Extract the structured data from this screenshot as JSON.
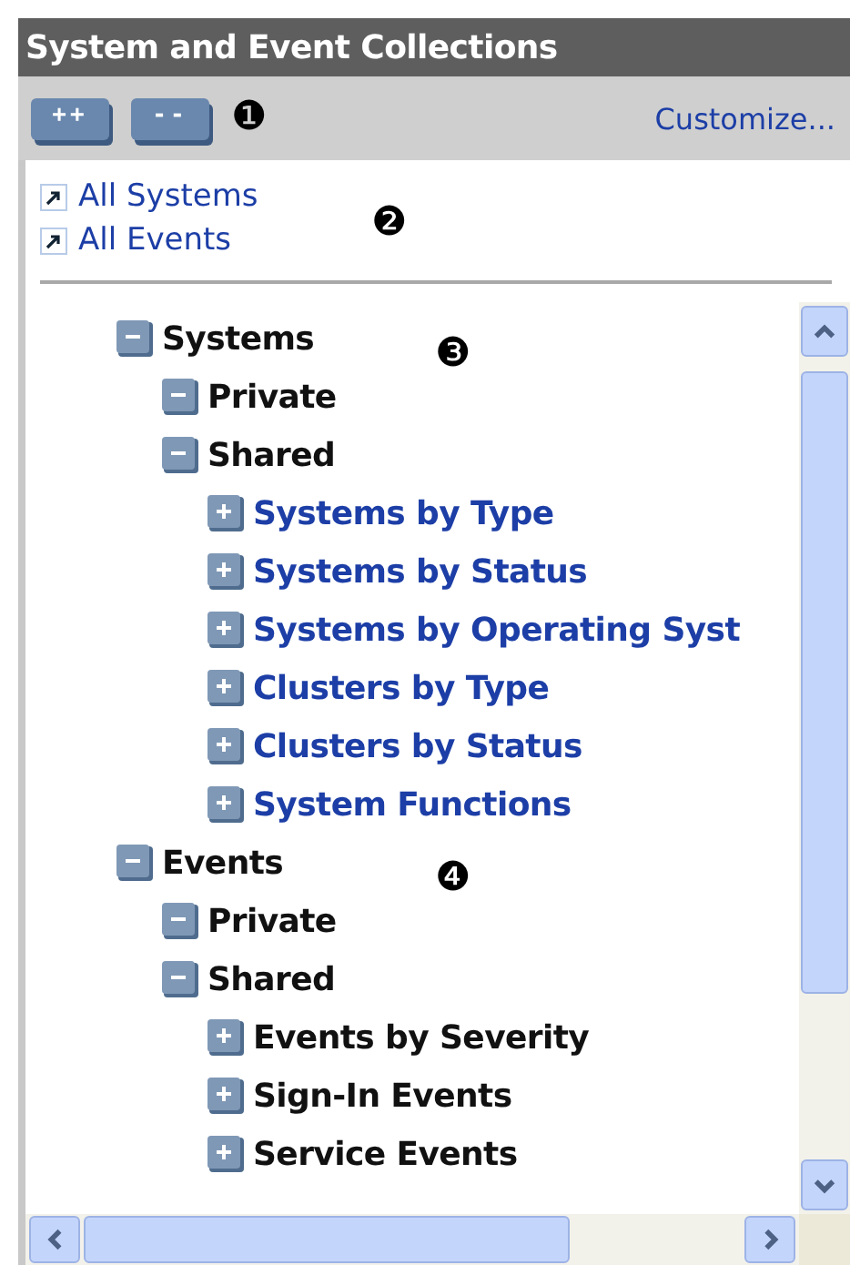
{
  "header": {
    "title": "System and Event Collections"
  },
  "toolbar": {
    "buttons": [
      {
        "label": "++"
      },
      {
        "label": "--"
      }
    ],
    "callout": "❶",
    "link": "Customize..."
  },
  "quick_links": {
    "items": [
      {
        "label": "All Systems"
      },
      {
        "label": "All Events"
      }
    ],
    "callout": "❷"
  },
  "tree": {
    "items": [
      {
        "label": "Systems",
        "expanded": true,
        "link": false,
        "callout": "❸",
        "children": [
          {
            "label": "Private",
            "expanded": true,
            "link": false
          },
          {
            "label": "Shared",
            "expanded": true,
            "link": false,
            "children": [
              {
                "label": "Systems by Type",
                "expanded": false,
                "link": true
              },
              {
                "label": "Systems by Status",
                "expanded": false,
                "link": true
              },
              {
                "label": "Systems by Operating Syst",
                "expanded": false,
                "link": true
              },
              {
                "label": "Clusters by Type",
                "expanded": false,
                "link": true
              },
              {
                "label": "Clusters by Status",
                "expanded": false,
                "link": true
              },
              {
                "label": "System Functions",
                "expanded": false,
                "link": true
              }
            ]
          }
        ]
      },
      {
        "label": "Events",
        "expanded": true,
        "link": false,
        "callout": "❹",
        "children": [
          {
            "label": "Private",
            "expanded": true,
            "link": false
          },
          {
            "label": "Shared",
            "expanded": true,
            "link": false,
            "children": [
              {
                "label": "Events by Severity",
                "expanded": false,
                "link": false
              },
              {
                "label": "Sign-In Events",
                "expanded": false,
                "link": false
              },
              {
                "label": "Service Events",
                "expanded": false,
                "link": false
              }
            ]
          }
        ]
      }
    ]
  }
}
